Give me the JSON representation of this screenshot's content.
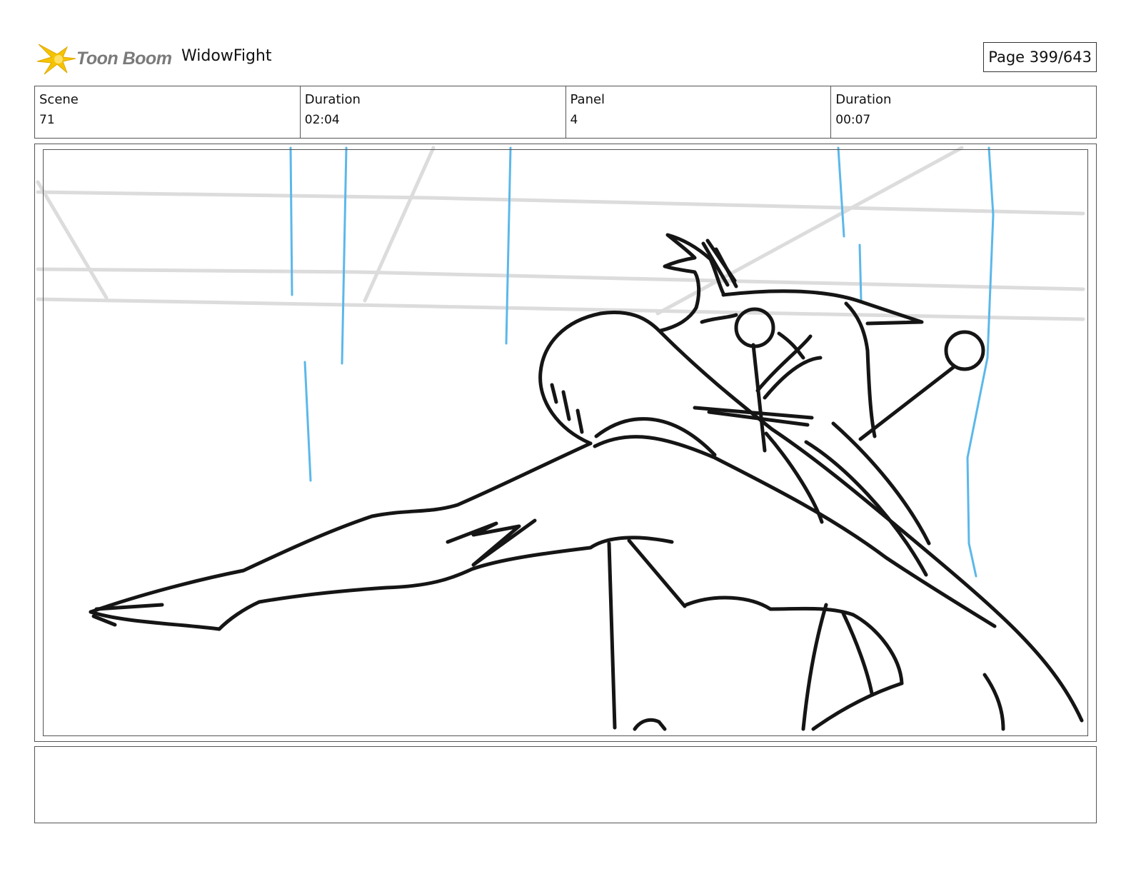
{
  "header": {
    "logo_text": "Toon Boom",
    "project_title": "WidowFight",
    "page_label": "Page 399/643"
  },
  "info": {
    "scene_label": "Scene",
    "scene_value": "71",
    "scene_duration_label": "Duration",
    "scene_duration_value": "02:04",
    "panel_label": "Panel",
    "panel_value": "4",
    "panel_duration_label": "Duration",
    "panel_duration_value": "00:07"
  },
  "colors": {
    "logo_star": "#f5c400",
    "sketch_ink": "#151515",
    "rain": "#5bb8ea",
    "background_lines": "#d8d8d8"
  },
  "caption": ""
}
